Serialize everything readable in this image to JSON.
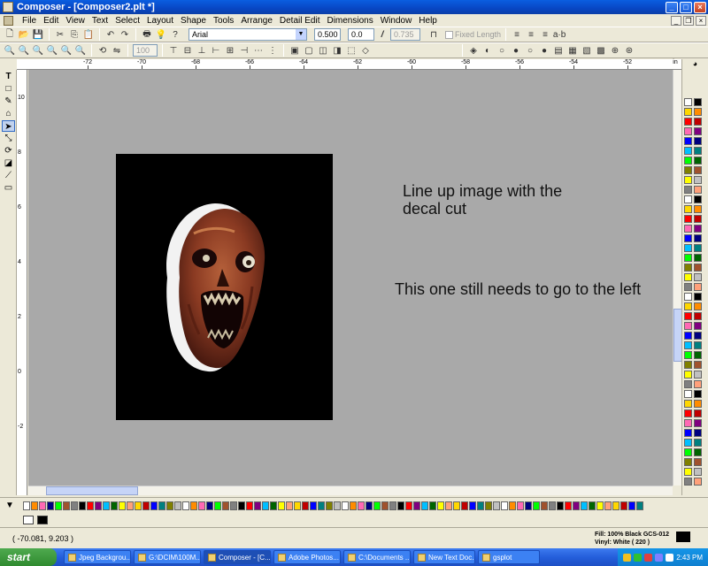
{
  "window": {
    "title": "Composer - [Composer2.plt *]"
  },
  "menu": [
    "File",
    "Edit",
    "View",
    "Text",
    "Select",
    "Layout",
    "Shape",
    "Tools",
    "Arrange",
    "Detail Edit",
    "Dimensions",
    "Window",
    "Help"
  ],
  "toolbar": {
    "font": "Arial",
    "size": "0.500",
    "spacing": "0.0",
    "slant": "0.735",
    "fixed_length": "Fixed Length",
    "zoom": "100"
  },
  "ruler": {
    "h_labels": [
      "-72",
      "-70",
      "-68",
      "-66",
      "-64",
      "-62",
      "-60",
      "-58",
      "-56",
      "-54",
      "-52"
    ],
    "units": "in",
    "v_labels": [
      "10",
      "8",
      "6",
      "4",
      "2",
      "0",
      "-2"
    ]
  },
  "canvas": {
    "annotation_1": "Line up image with the decal cut",
    "annotation_2": "This one still needs to go to the left"
  },
  "status": {
    "coords": "( -70.081, 9.203 )",
    "fill": "Fill: 100% Black GCS-012",
    "vinyl": "Vinyl: White ( 220 )"
  },
  "taskbar": {
    "start": "start",
    "tasks": [
      "Jpeg Backgrou...",
      "G:\\DCIM\\100M...",
      "Composer - [C...",
      "Adobe Photos...",
      "C:\\Documents ...",
      "New Text Doc...",
      "gsplot"
    ],
    "time": "2:43 PM"
  },
  "palette_colors": [
    "#ffffff",
    "#000000",
    "#ffd700",
    "#ff8c00",
    "#ff0000",
    "#c00000",
    "#ff69b4",
    "#800080",
    "#0000ff",
    "#000080",
    "#00bfff",
    "#008080",
    "#00ff00",
    "#006400",
    "#808000",
    "#a0522d",
    "#ffff00",
    "#c0c0c0",
    "#808080",
    "#ffa07a"
  ]
}
